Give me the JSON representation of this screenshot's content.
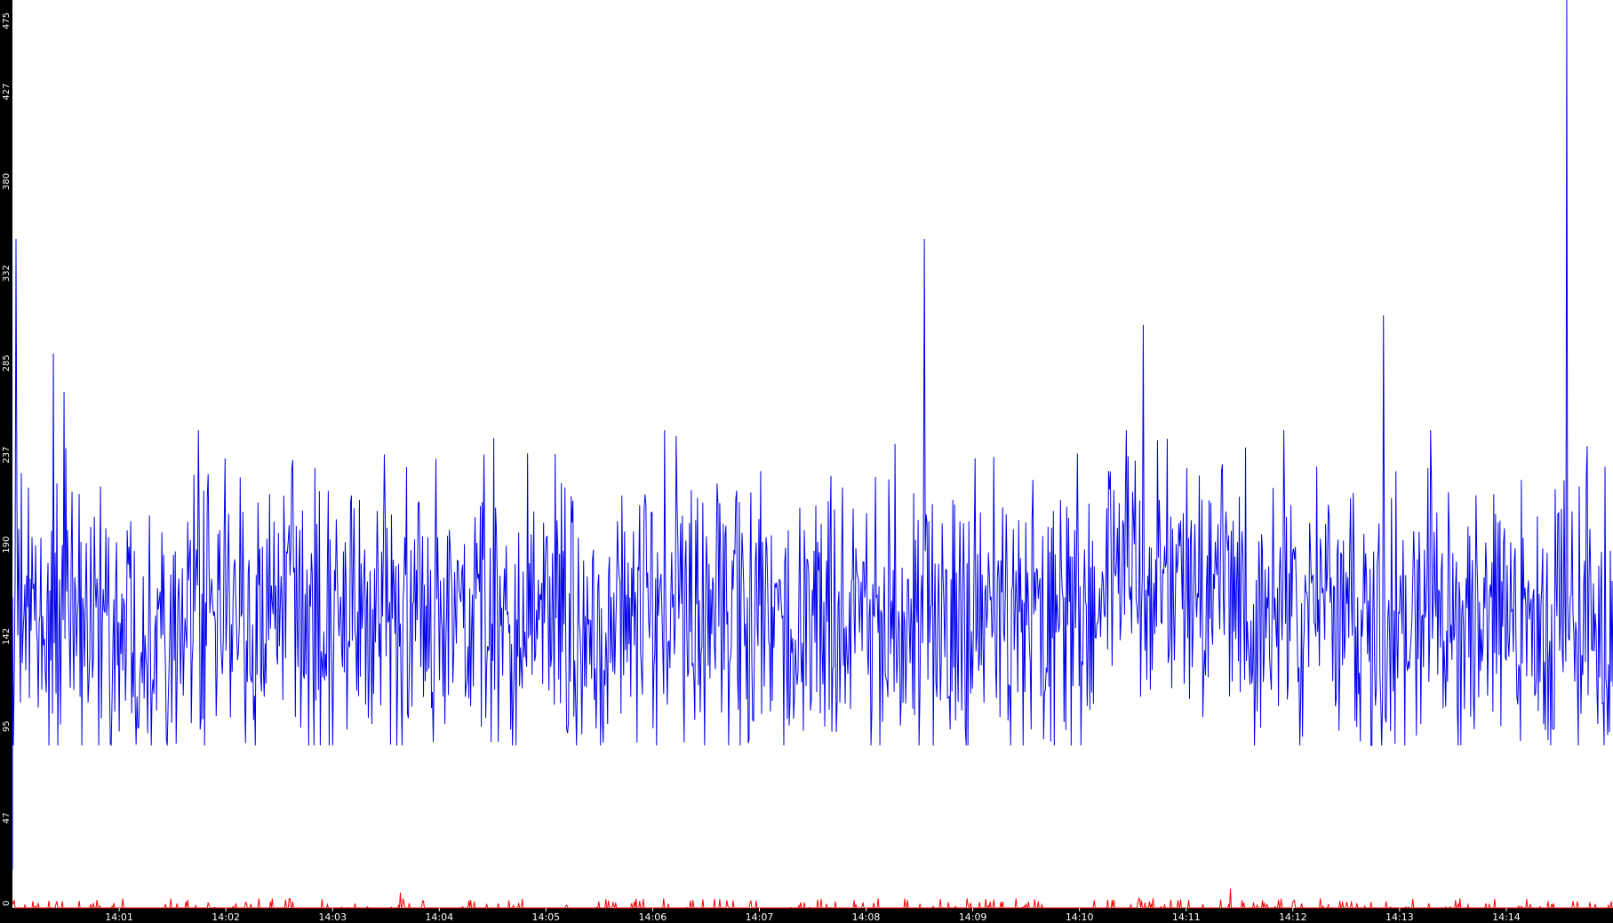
{
  "colors": {
    "background": "#ffffff",
    "axis_background": "#000000",
    "axis_text": "#ffffff",
    "series_primary": "#0000ee",
    "series_secondary": "#ff0000"
  },
  "chart_data": {
    "type": "line",
    "title": "",
    "xlabel": "",
    "ylabel": "",
    "grid": false,
    "legend": "none",
    "y_ticks": [
      0,
      47,
      95,
      142,
      190,
      237,
      285,
      332,
      380,
      427,
      475
    ],
    "ylim": [
      0,
      475
    ],
    "x_ticks": [
      "14:01",
      "14:02",
      "14:03",
      "14:04",
      "14:05",
      "14:06",
      "14:07",
      "14:08",
      "14:09",
      "14:10",
      "14:11",
      "14:12",
      "14:13",
      "14:14"
    ],
    "xlim": [
      "14:00:00",
      "14:15:00"
    ],
    "series": [
      {
        "color": "#0000ee",
        "baseline": 150,
        "spikes": [
          {
            "time": "14:00:02",
            "value": 350
          },
          {
            "time": "14:00:23",
            "value": 290
          },
          {
            "time": "14:00:29",
            "value": 270
          },
          {
            "time": "14:08:33",
            "value": 350
          },
          {
            "time": "14:10:36",
            "value": 305
          },
          {
            "time": "14:12:51",
            "value": 310
          },
          {
            "time": "14:14:34",
            "value": 475
          }
        ]
      },
      {
        "color": "#ff0000",
        "baseline": 2,
        "spikes": [
          {
            "time": "14:03:38",
            "value": 8
          },
          {
            "time": "14:11:25",
            "value": 10
          }
        ]
      }
    ]
  }
}
